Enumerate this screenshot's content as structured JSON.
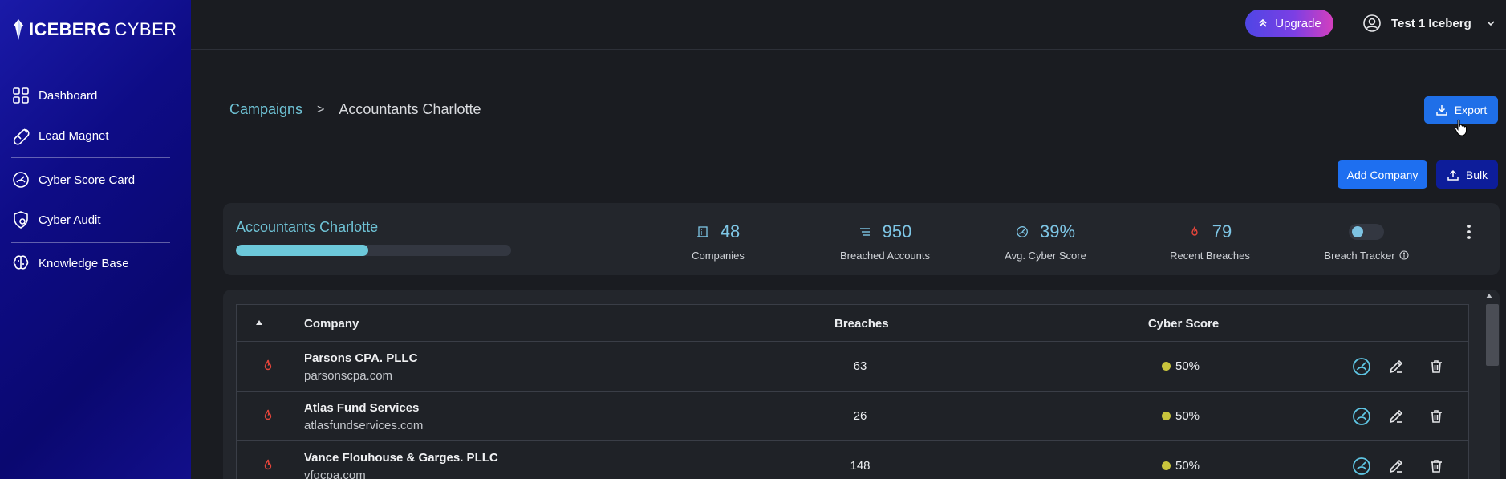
{
  "brand": {
    "bold": "ICEBERG",
    "light": "CYBER"
  },
  "sidebar": {
    "items": [
      {
        "label": "Dashboard",
        "icon": "grid-icon"
      },
      {
        "label": "Lead Magnet",
        "icon": "magnet-icon"
      },
      {
        "label": "Cyber Score Card",
        "icon": "gauge-icon"
      },
      {
        "label": "Cyber Audit",
        "icon": "shield-search-icon"
      },
      {
        "label": "Knowledge Base",
        "icon": "brain-icon"
      }
    ]
  },
  "topbar": {
    "upgrade_label": "Upgrade",
    "user_name": "Test 1 Iceberg"
  },
  "breadcrumb": {
    "root": "Campaigns",
    "separator": ">",
    "current": "Accountants Charlotte"
  },
  "actions": {
    "export_label": "Export",
    "add_company_label": "Add Company",
    "bulk_label": "Bulk"
  },
  "campaign": {
    "name": "Accountants Charlotte",
    "progress": 0.48,
    "stats": [
      {
        "value": "48",
        "label": "Companies",
        "icon": "building-icon"
      },
      {
        "value": "950",
        "label": "Breached Accounts",
        "icon": "list-icon"
      },
      {
        "value": "39%",
        "label": "Avg. Cyber Score",
        "icon": "gauge-icon"
      },
      {
        "value": "79",
        "label": "Recent Breaches",
        "icon": "flame-icon"
      }
    ],
    "breach_tracker_label": "Breach Tracker"
  },
  "table": {
    "headers": {
      "company": "Company",
      "breaches": "Breaches",
      "cyber_score": "Cyber Score"
    },
    "rows": [
      {
        "name": "Parsons CPA. PLLC",
        "domain": "parsonscpa.com",
        "breaches": "63",
        "score": "50%"
      },
      {
        "name": "Atlas Fund Services",
        "domain": "atlasfundservices.com",
        "breaches": "26",
        "score": "50%"
      },
      {
        "name": "Vance Flouhouse & Garges. PLLC",
        "domain": "vfgcpa.com",
        "breaches": "148",
        "score": "50%"
      }
    ]
  },
  "colors": {
    "accent": "#6fc3d6",
    "primary_button": "#1f6fe8",
    "bulk_button": "#0d1d9a",
    "flame": "#e5453b",
    "score_dot": "#c8c43c"
  }
}
